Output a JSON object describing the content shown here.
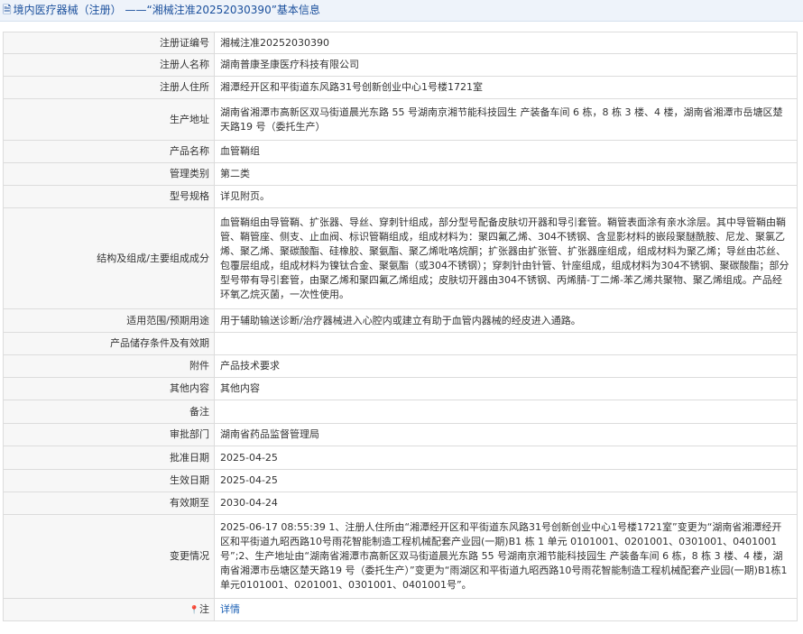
{
  "header": {
    "icon": "document-icon",
    "category": "境内医疗器械（注册）",
    "separator": "——",
    "reg_number_quoted": "“湘械注准20252030390”",
    "suffix": "基本信息"
  },
  "rows": {
    "reg_no": {
      "label": "注册证编号",
      "value": "湘械注准20252030390"
    },
    "registrant": {
      "label": "注册人名称",
      "value": "湖南普康圣康医疗科技有限公司"
    },
    "residence": {
      "label": "注册人住所",
      "value": "湘潭经开区和平街道东风路31号创新创业中心1号楼1721室"
    },
    "production": {
      "label": "生产地址",
      "value": "湖南省湘潭市高新区双马街道晨光东路 55 号湖南京湘节能科技园生 产装备车间 6 栋，8 栋 3 楼、4 楼，湖南省湘潭市岳塘区楚天路19 号（委托生产）"
    },
    "product": {
      "label": "产品名称",
      "value": "血管鞘组"
    },
    "class": {
      "label": "管理类别",
      "value": "第二类"
    },
    "model": {
      "label": "型号规格",
      "value": "详见附页。"
    },
    "structure": {
      "label": "结构及组成/主要组成成分",
      "value": "血管鞘组由导管鞘、扩张器、导丝、穿刺针组成，部分型号配备皮肤切开器和导引套管。鞘管表面涂有亲水涂层。其中导管鞘由鞘管、鞘管座、侧支、止血阀、标识管鞘组成，组成材料为：聚四氟乙烯、304不锈钢、含显影材料的嵌段聚醚酰胺、尼龙、聚氯乙烯、聚乙烯、聚碳酸酯、硅橡胶、聚氨酯、聚乙烯吡咯烷酮；扩张器由扩张管、扩张器座组成，组成材料为聚乙烯；导丝由芯丝、包覆层组成，组成材料为镍钛合金、聚氨酯（或304不锈钢）；穿刺针由针管、针座组成，组成材料为304不锈钢、聚碳酸酯；部分型号带有导引套管，由聚乙烯和聚四氟乙烯组成；皮肤切开器由304不锈钢、丙烯腈-丁二烯-苯乙烯共聚物、聚乙烯组成。产品经环氧乙烷灭菌，一次性使用。"
    },
    "scope": {
      "label": "适用范围/预期用途",
      "value": "用于辅助输送诊断/治疗器械进入心腔内或建立有助于血管内器械的经皮进入通路。"
    },
    "storage": {
      "label": "产品储存条件及有效期",
      "value": ""
    },
    "attachment": {
      "label": "附件",
      "value": "产品技术要求"
    },
    "other": {
      "label": "其他内容",
      "value": "其他内容"
    },
    "remark": {
      "label": "备注",
      "value": ""
    },
    "dept": {
      "label": "审批部门",
      "value": "湖南省药品监督管理局"
    },
    "approve_date": {
      "label": "批准日期",
      "value": "2025-04-25"
    },
    "effective_date": {
      "label": "生效日期",
      "value": "2025-04-25"
    },
    "expiry": {
      "label": "有效期至",
      "value": "2030-04-24"
    },
    "change": {
      "label": "变更情况",
      "value": "2025-06-17 08:55:39 1、注册人住所由“湘潭经开区和平街道东风路31号创新创业中心1号楼1721室”变更为“湖南省湘潭经开区和平街道九昭西路10号雨花智能制造工程机械配套产业园(一期)B1 栋 1 单元 0101001、0201001、0301001、0401001 号”;2、生产地址由“湖南省湘潭市高新区双马街道晨光东路 55 号湖南京湘节能科技园生 产装备车间 6 栋，8 栋 3 楼、4 楼，湖南省湘潭市岳塘区楚天路19 号（委托生产）”变更为“雨湖区和平街道九昭西路10号雨花智能制造工程机械配套产业园(一期)B1栋1单元0101001、0201001、0301001、0401001号”。"
    },
    "note": {
      "label": "注",
      "icon": "pin-icon",
      "link": "详情"
    }
  }
}
